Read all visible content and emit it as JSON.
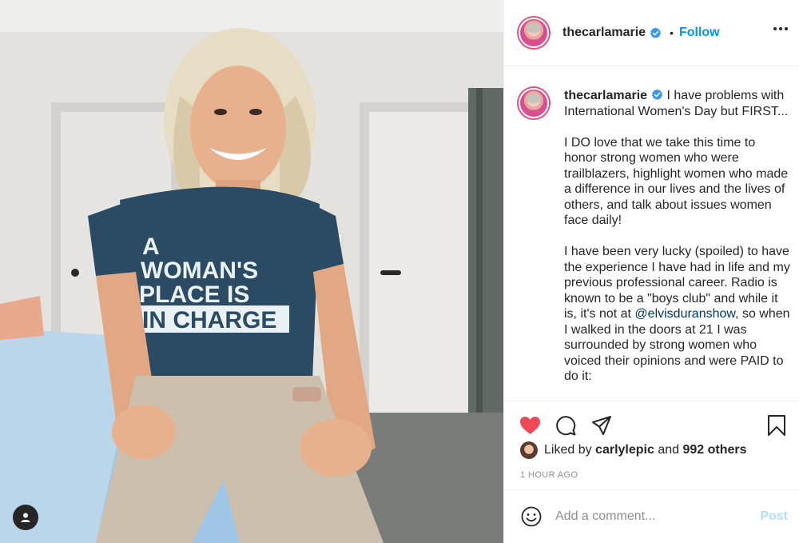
{
  "post": {
    "username": "thecarlamarie",
    "separator": "•",
    "follow_label": "Follow",
    "more_icon": "more-options-icon",
    "verified_icon": "verified-badge-icon",
    "verified_color": "#3897f0"
  },
  "photo": {
    "shirt_lines": [
      "A",
      "WOMAN'S",
      "PLACE IS",
      "IN CHARGE"
    ],
    "tag_icon": "user-tag-icon"
  },
  "caption": {
    "username": "thecarlamarie",
    "paragraph_1": "I have problems with International Women's Day but FIRST...",
    "paragraph_2": "I DO love that we take this time to honor strong women who were trailblazers, highlight women who made a difference in our lives and the lives of others, and talk about issues women face daily!",
    "paragraph_3_before": "I have been very lucky (spoiled) to have the experience I have had in life and my previous professional career. Radio is known to be a \"boys club\" and while it is, it's not at ",
    "paragraph_3_mention": "@elvisduranshow",
    "paragraph_3_after": ", so when I walked in the doors at 21 I was surrounded by strong women who voiced their opinions and were PAID to do it:"
  },
  "actions": {
    "like_icon": "heart-filled-icon",
    "like_color": "#ed4956",
    "comment_icon": "comment-icon",
    "share_icon": "share-icon",
    "save_icon": "bookmark-icon"
  },
  "likes": {
    "prefix": "Liked by",
    "user": "carlylepic",
    "connector": "and",
    "others": "992 others"
  },
  "timestamp": "1 HOUR AGO",
  "comment": {
    "placeholder": "Add a comment...",
    "post_label": "Post",
    "emoji_icon": "emoji-icon"
  },
  "colors": {
    "accent": "#0095f6",
    "post_disabled": "#b2dffc"
  }
}
